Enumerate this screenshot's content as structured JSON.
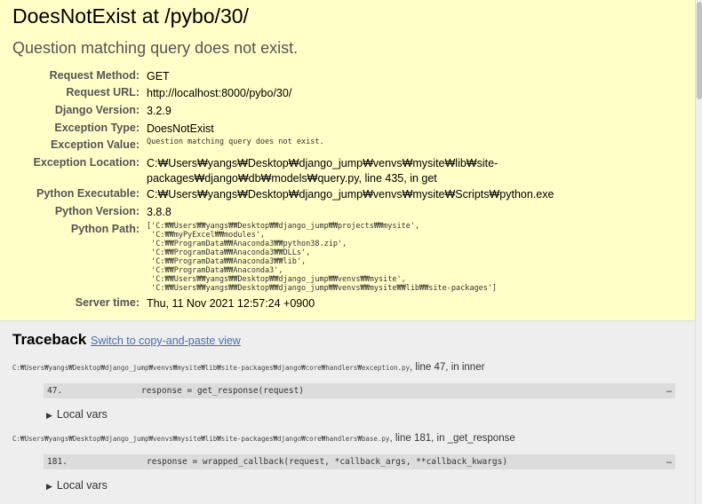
{
  "summary": {
    "title": "DoesNotExist at /pybo/30/",
    "subtitle": "Question matching query does not exist.",
    "rows": [
      {
        "label": "Request Method:",
        "value": "GET"
      },
      {
        "label": "Request URL:",
        "value": "http://localhost:8000/pybo/30/"
      },
      {
        "label": "Django Version:",
        "value": "3.2.9"
      },
      {
        "label": "Exception Type:",
        "value": "DoesNotExist"
      },
      {
        "label": "Exception Value:",
        "value": "Question matching query does not exist."
      },
      {
        "label": "Exception Location:",
        "value": "C:₩Users₩yangs₩Desktop₩django_jump₩venvs₩mysite₩lib₩site-packages₩django₩db₩models₩query.py, line 435, in get"
      },
      {
        "label": "Python Executable:",
        "value": "C:₩Users₩yangs₩Desktop₩django_jump₩venvs₩mysite₩Scripts₩python.exe"
      },
      {
        "label": "Python Version:",
        "value": "3.8.8"
      },
      {
        "label": "Python Path:",
        "value": "['C:₩₩Users₩₩yangs₩₩Desktop₩₩django_jump₩₩projects₩₩mysite',\n 'C:₩₩myPyExcel₩₩modules',\n 'C:₩₩ProgramData₩₩Anaconda3₩₩python38.zip',\n 'C:₩₩ProgramData₩₩Anaconda3₩₩DLLs',\n 'C:₩₩ProgramData₩₩Anaconda3₩₩lib',\n 'C:₩₩ProgramData₩₩Anaconda3',\n 'C:₩₩Users₩₩yangs₩₩Desktop₩₩django_jump₩₩venvs₩₩mysite',\n 'C:₩₩Users₩₩yangs₩₩Desktop₩₩django_jump₩₩venvs₩₩mysite₩₩lib₩₩site-packages']"
      },
      {
        "label": "Server time:",
        "value": "Thu, 11 Nov 2021 12:57:24 +0900"
      }
    ]
  },
  "traceback": {
    "heading": "Traceback",
    "copy_link": "Switch to copy-and-paste view",
    "frames": [
      {
        "path": "C:₩Users₩yangs₩Desktop₩django_jump₩venvs₩mysite₩lib₩site-packages₩django₩core₩handlers₩exception.py",
        "location": ", line 47, in inner",
        "lineno": "47.",
        "code": "response = get_response(request)",
        "ellipsis": "…",
        "local_vars": "Local vars"
      },
      {
        "path": "C:₩Users₩yangs₩Desktop₩django_jump₩venvs₩mysite₩lib₩site-packages₩django₩core₩handlers₩base.py",
        "location": ", line 181, in _get_response",
        "lineno": "181.",
        "code": "response = wrapped_callback(request, *callback_args, **callback_kwargs)",
        "ellipsis": "…",
        "local_vars": "Local vars"
      }
    ]
  },
  "colors": {
    "summary_bg": "#ffffc8",
    "traceback_bg": "#eeeeee",
    "link": "#4a6ea9",
    "code_bg": "#dcdcdc"
  }
}
